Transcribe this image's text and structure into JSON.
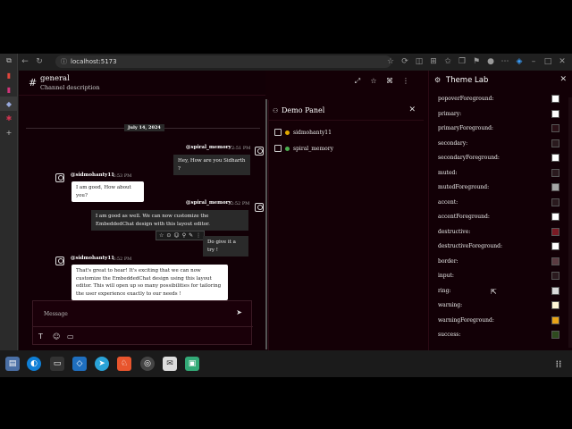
{
  "browser": {
    "url": "localhost:5173"
  },
  "chat": {
    "channel_name": "general",
    "channel_description": "Channel description",
    "date_divider": "July 14, 2024",
    "messages": [
      {
        "author": "@spiral_memory",
        "time": "2:51 PM",
        "text": "Hey, How are you Sidharth ?"
      },
      {
        "author": "@sidmohanty11",
        "time": "2:53 PM",
        "text": "I am good, How about you?"
      },
      {
        "author": "@spiral_memory",
        "time": "2:52 PM",
        "text": "I am good as well. We can now customize the EmbeddedChat design with this layout editor.",
        "text2": "Do give it a try !"
      },
      {
        "author": "@sidmohanty11",
        "time": "2:52 PM",
        "text": "That's great to hear! It's exciting that we can now customize the EmbeddedChat design using this layout editor. This will open up so many possibilities for tailoring the user experience exactly to our needs !"
      }
    ],
    "composer_placeholder": "Message"
  },
  "demo_panel": {
    "title": "Demo Panel",
    "members": [
      {
        "name": "sidmohanty11",
        "status_color": "#e0a800"
      },
      {
        "name": "spiral_memory",
        "status_color": "#4caf50"
      }
    ]
  },
  "theme_lab": {
    "title": "Theme Lab",
    "rows": [
      {
        "label": "popoverForeground:",
        "color": "#ffffff"
      },
      {
        "label": "primary:",
        "color": "#ffffff"
      },
      {
        "label": "primaryForeground:",
        "color": "#2a1016"
      },
      {
        "label": "secondary:",
        "color": "#2a1a1e"
      },
      {
        "label": "secondaryForeground:",
        "color": "#ffffff"
      },
      {
        "label": "muted:",
        "color": "#2a1a1e"
      },
      {
        "label": "mutedForeground:",
        "color": "#a6a6a6"
      },
      {
        "label": "accent:",
        "color": "#2a1a1e"
      },
      {
        "label": "accentForeground:",
        "color": "#ffffff"
      },
      {
        "label": "destructive:",
        "color": "#7a1a24"
      },
      {
        "label": "destructiveForeground:",
        "color": "#ffffff"
      },
      {
        "label": "border:",
        "color": "#5a3a40"
      },
      {
        "label": "input:",
        "color": "#2a1a1e"
      },
      {
        "label": "ring:",
        "color": "#d9d9d9"
      },
      {
        "label": "warning:",
        "color": "#fff7d6"
      },
      {
        "label": "warningForeground:",
        "color": "#e8a317"
      },
      {
        "label": "success:",
        "color": "#2e4a1e"
      }
    ]
  }
}
